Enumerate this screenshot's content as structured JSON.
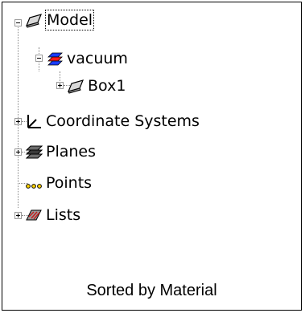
{
  "tree": {
    "items": [
      {
        "label": "Model",
        "icon": "block-icon"
      },
      {
        "label": "vacuum",
        "icon": "material-icon"
      },
      {
        "label": "Box1",
        "icon": "block-icon"
      },
      {
        "label": "Coordinate Systems",
        "icon": "axes-icon"
      },
      {
        "label": "Planes",
        "icon": "planes-icon"
      },
      {
        "label": "Points",
        "icon": "points-icon"
      },
      {
        "label": "Lists",
        "icon": "lists-icon"
      }
    ]
  },
  "footer": {
    "caption": "Sorted by Material"
  }
}
